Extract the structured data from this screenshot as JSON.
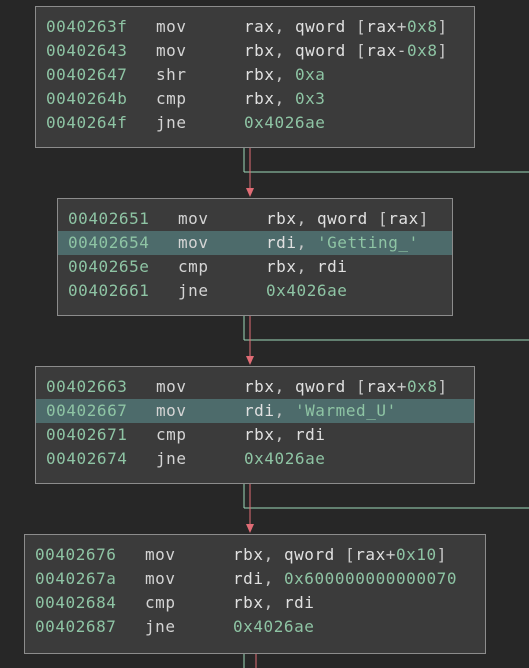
{
  "colors": {
    "background": "#272727",
    "block_bg": "#3b3b3b",
    "block_border": "#8c8c8c",
    "highlight_bg": "#4d6b6b",
    "address": "#8ec4a4",
    "text": "#d4d4d4",
    "edge_taken": "#e06c75",
    "edge_fallthrough": "#9ed8b8"
  },
  "blocks": [
    {
      "name": "block-0040263f",
      "rows": [
        {
          "addr": "0040263f",
          "mnemonic": "mov",
          "highlight": false,
          "ops": [
            {
              "t": "reg",
              "v": "rax"
            },
            {
              "t": "p",
              "v": ", "
            },
            {
              "t": "reg",
              "v": "qword"
            },
            {
              "t": "p",
              "v": " ["
            },
            {
              "t": "reg",
              "v": "rax"
            },
            {
              "t": "p",
              "v": "+"
            },
            {
              "t": "num",
              "v": "0x8"
            },
            {
              "t": "p",
              "v": "]"
            }
          ]
        },
        {
          "addr": "00402643",
          "mnemonic": "mov",
          "highlight": false,
          "ops": [
            {
              "t": "reg",
              "v": "rbx"
            },
            {
              "t": "p",
              "v": ", "
            },
            {
              "t": "reg",
              "v": "qword"
            },
            {
              "t": "p",
              "v": " ["
            },
            {
              "t": "reg",
              "v": "rax"
            },
            {
              "t": "p",
              "v": "-"
            },
            {
              "t": "num",
              "v": "0x8"
            },
            {
              "t": "p",
              "v": "]"
            }
          ]
        },
        {
          "addr": "00402647",
          "mnemonic": "shr",
          "highlight": false,
          "ops": [
            {
              "t": "reg",
              "v": "rbx"
            },
            {
              "t": "p",
              "v": ", "
            },
            {
              "t": "num",
              "v": "0xa"
            }
          ]
        },
        {
          "addr": "0040264b",
          "mnemonic": "cmp",
          "highlight": false,
          "ops": [
            {
              "t": "reg",
              "v": "rbx"
            },
            {
              "t": "p",
              "v": ", "
            },
            {
              "t": "num",
              "v": "0x3"
            }
          ]
        },
        {
          "addr": "0040264f",
          "mnemonic": "jne",
          "highlight": false,
          "ops": [
            {
              "t": "num",
              "v": "0x4026ae"
            }
          ]
        }
      ]
    },
    {
      "name": "block-00402651",
      "rows": [
        {
          "addr": "00402651",
          "mnemonic": "mov",
          "highlight": false,
          "ops": [
            {
              "t": "reg",
              "v": "rbx"
            },
            {
              "t": "p",
              "v": ", "
            },
            {
              "t": "reg",
              "v": "qword"
            },
            {
              "t": "p",
              "v": " ["
            },
            {
              "t": "reg",
              "v": "rax"
            },
            {
              "t": "p",
              "v": "]"
            }
          ]
        },
        {
          "addr": "00402654",
          "mnemonic": "mov",
          "highlight": true,
          "ops": [
            {
              "t": "reg",
              "v": "rdi"
            },
            {
              "t": "p",
              "v": ", "
            },
            {
              "t": "str",
              "v": "'Getting_'"
            }
          ]
        },
        {
          "addr": "0040265e",
          "mnemonic": "cmp",
          "highlight": false,
          "ops": [
            {
              "t": "reg",
              "v": "rbx"
            },
            {
              "t": "p",
              "v": ", "
            },
            {
              "t": "reg",
              "v": "rdi"
            }
          ]
        },
        {
          "addr": "00402661",
          "mnemonic": "jne",
          "highlight": false,
          "ops": [
            {
              "t": "num",
              "v": "0x4026ae"
            }
          ]
        }
      ]
    },
    {
      "name": "block-00402663",
      "rows": [
        {
          "addr": "00402663",
          "mnemonic": "mov",
          "highlight": false,
          "ops": [
            {
              "t": "reg",
              "v": "rbx"
            },
            {
              "t": "p",
              "v": ", "
            },
            {
              "t": "reg",
              "v": "qword"
            },
            {
              "t": "p",
              "v": " ["
            },
            {
              "t": "reg",
              "v": "rax"
            },
            {
              "t": "p",
              "v": "+"
            },
            {
              "t": "num",
              "v": "0x8"
            },
            {
              "t": "p",
              "v": "]"
            }
          ]
        },
        {
          "addr": "00402667",
          "mnemonic": "mov",
          "highlight": true,
          "ops": [
            {
              "t": "reg",
              "v": "rdi"
            },
            {
              "t": "p",
              "v": ", "
            },
            {
              "t": "str",
              "v": "'Warmed_U'"
            }
          ]
        },
        {
          "addr": "00402671",
          "mnemonic": "cmp",
          "highlight": false,
          "ops": [
            {
              "t": "reg",
              "v": "rbx"
            },
            {
              "t": "p",
              "v": ", "
            },
            {
              "t": "reg",
              "v": "rdi"
            }
          ]
        },
        {
          "addr": "00402674",
          "mnemonic": "jne",
          "highlight": false,
          "ops": [
            {
              "t": "num",
              "v": "0x4026ae"
            }
          ]
        }
      ]
    },
    {
      "name": "block-00402676",
      "rows": [
        {
          "addr": "00402676",
          "mnemonic": "mov",
          "highlight": false,
          "ops": [
            {
              "t": "reg",
              "v": "rbx"
            },
            {
              "t": "p",
              "v": ", "
            },
            {
              "t": "reg",
              "v": "qword"
            },
            {
              "t": "p",
              "v": " ["
            },
            {
              "t": "reg",
              "v": "rax"
            },
            {
              "t": "p",
              "v": "+"
            },
            {
              "t": "num",
              "v": "0x10"
            },
            {
              "t": "p",
              "v": "]"
            }
          ]
        },
        {
          "addr": "0040267a",
          "mnemonic": "mov",
          "highlight": false,
          "ops": [
            {
              "t": "reg",
              "v": "rdi"
            },
            {
              "t": "p",
              "v": ", "
            },
            {
              "t": "num",
              "v": "0x600000000000070"
            }
          ]
        },
        {
          "addr": "00402684",
          "mnemonic": "cmp",
          "highlight": false,
          "ops": [
            {
              "t": "reg",
              "v": "rbx"
            },
            {
              "t": "p",
              "v": ", "
            },
            {
              "t": "reg",
              "v": "rdi"
            }
          ]
        },
        {
          "addr": "00402687",
          "mnemonic": "jne",
          "highlight": false,
          "ops": [
            {
              "t": "num",
              "v": "0x4026ae"
            }
          ]
        }
      ]
    }
  ]
}
